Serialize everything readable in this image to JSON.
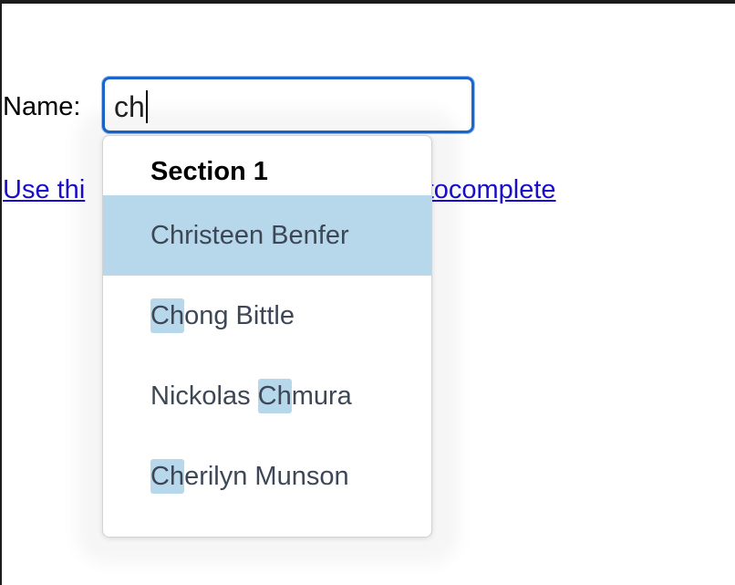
{
  "form": {
    "name_label": "Name:",
    "name_value": "ch",
    "link_text_left": "Use thi",
    "link_text_right": "e autocomplete"
  },
  "dropdown": {
    "section_title": "Section 1",
    "options": [
      {
        "pre": "",
        "match": "",
        "post": "Christeen Benfer",
        "active": true
      },
      {
        "pre": "",
        "match": "Ch",
        "post": "ong Bittle",
        "active": false
      },
      {
        "pre": "Nickolas ",
        "match": "Ch",
        "post": "mura",
        "active": false
      },
      {
        "pre": "",
        "match": "Ch",
        "post": "erilyn Munson",
        "active": false
      }
    ]
  },
  "colors": {
    "focus_border": "#1a66cc",
    "highlight": "#b7d7ea",
    "link": "#1a0dcc"
  }
}
